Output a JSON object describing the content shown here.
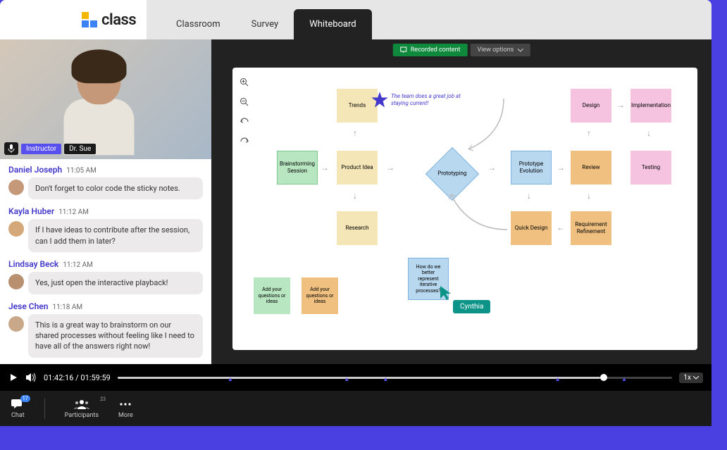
{
  "logo": {
    "text": "class"
  },
  "tabs": {
    "classroom": "Classroom",
    "survey": "Survey",
    "whiteboard": "Whiteboard"
  },
  "instructor": {
    "role": "Instructor",
    "name": "Dr. Sue"
  },
  "chat": [
    {
      "name": "Daniel Joseph",
      "time": "11:05 AM",
      "text": "Don't forget to color code the sticky notes."
    },
    {
      "name": "Kayla Huber",
      "time": "11:12 AM",
      "text": "If I have ideas to contribute after the session, can I add them in later?"
    },
    {
      "name": "Lindsay Beck",
      "time": "11:12 AM",
      "text": "Yes, just open the interactive playback!"
    },
    {
      "name": "Jese Chen",
      "time": "11:18 AM",
      "text": "This is a great way to brainstorm on our shared processes without feeling like I need to have all of the answers right now!"
    }
  ],
  "recording": {
    "label": "Recorded content",
    "view": "View options"
  },
  "whiteboard": {
    "note": "The team does a great job at staying current!",
    "nodes": {
      "trends": "Trends",
      "brainstorm": "Brainstorming Session",
      "product": "Product Idea",
      "research": "Research",
      "proto": "Prototyping",
      "evolution": "Prototype Evolution",
      "quick": "Quick Design",
      "requirement": "Requirement Refinement",
      "review": "Review",
      "design": "Design",
      "impl": "Implementation",
      "testing": "Testing",
      "question": "How do we better represent iterative processes?",
      "addq1": "Add your questions or ideas",
      "addq2": "Add your questions or ideas"
    },
    "cursor_user": "Cynthia"
  },
  "player": {
    "current": "01:42:16",
    "total": "01:59:59",
    "speed": "1x"
  },
  "toolbar": {
    "chat": "Chat",
    "participants": "Participants",
    "more": "More",
    "chat_count": "17",
    "part_count": "23"
  },
  "colors": {
    "cream": "#f5e6b8",
    "green": "#b8e6c1",
    "orange": "#f0c080",
    "pink": "#f5c2e0",
    "blue": "#b8d8f0",
    "blueborder": "#7db3e0",
    "teal": "#0d9488"
  }
}
